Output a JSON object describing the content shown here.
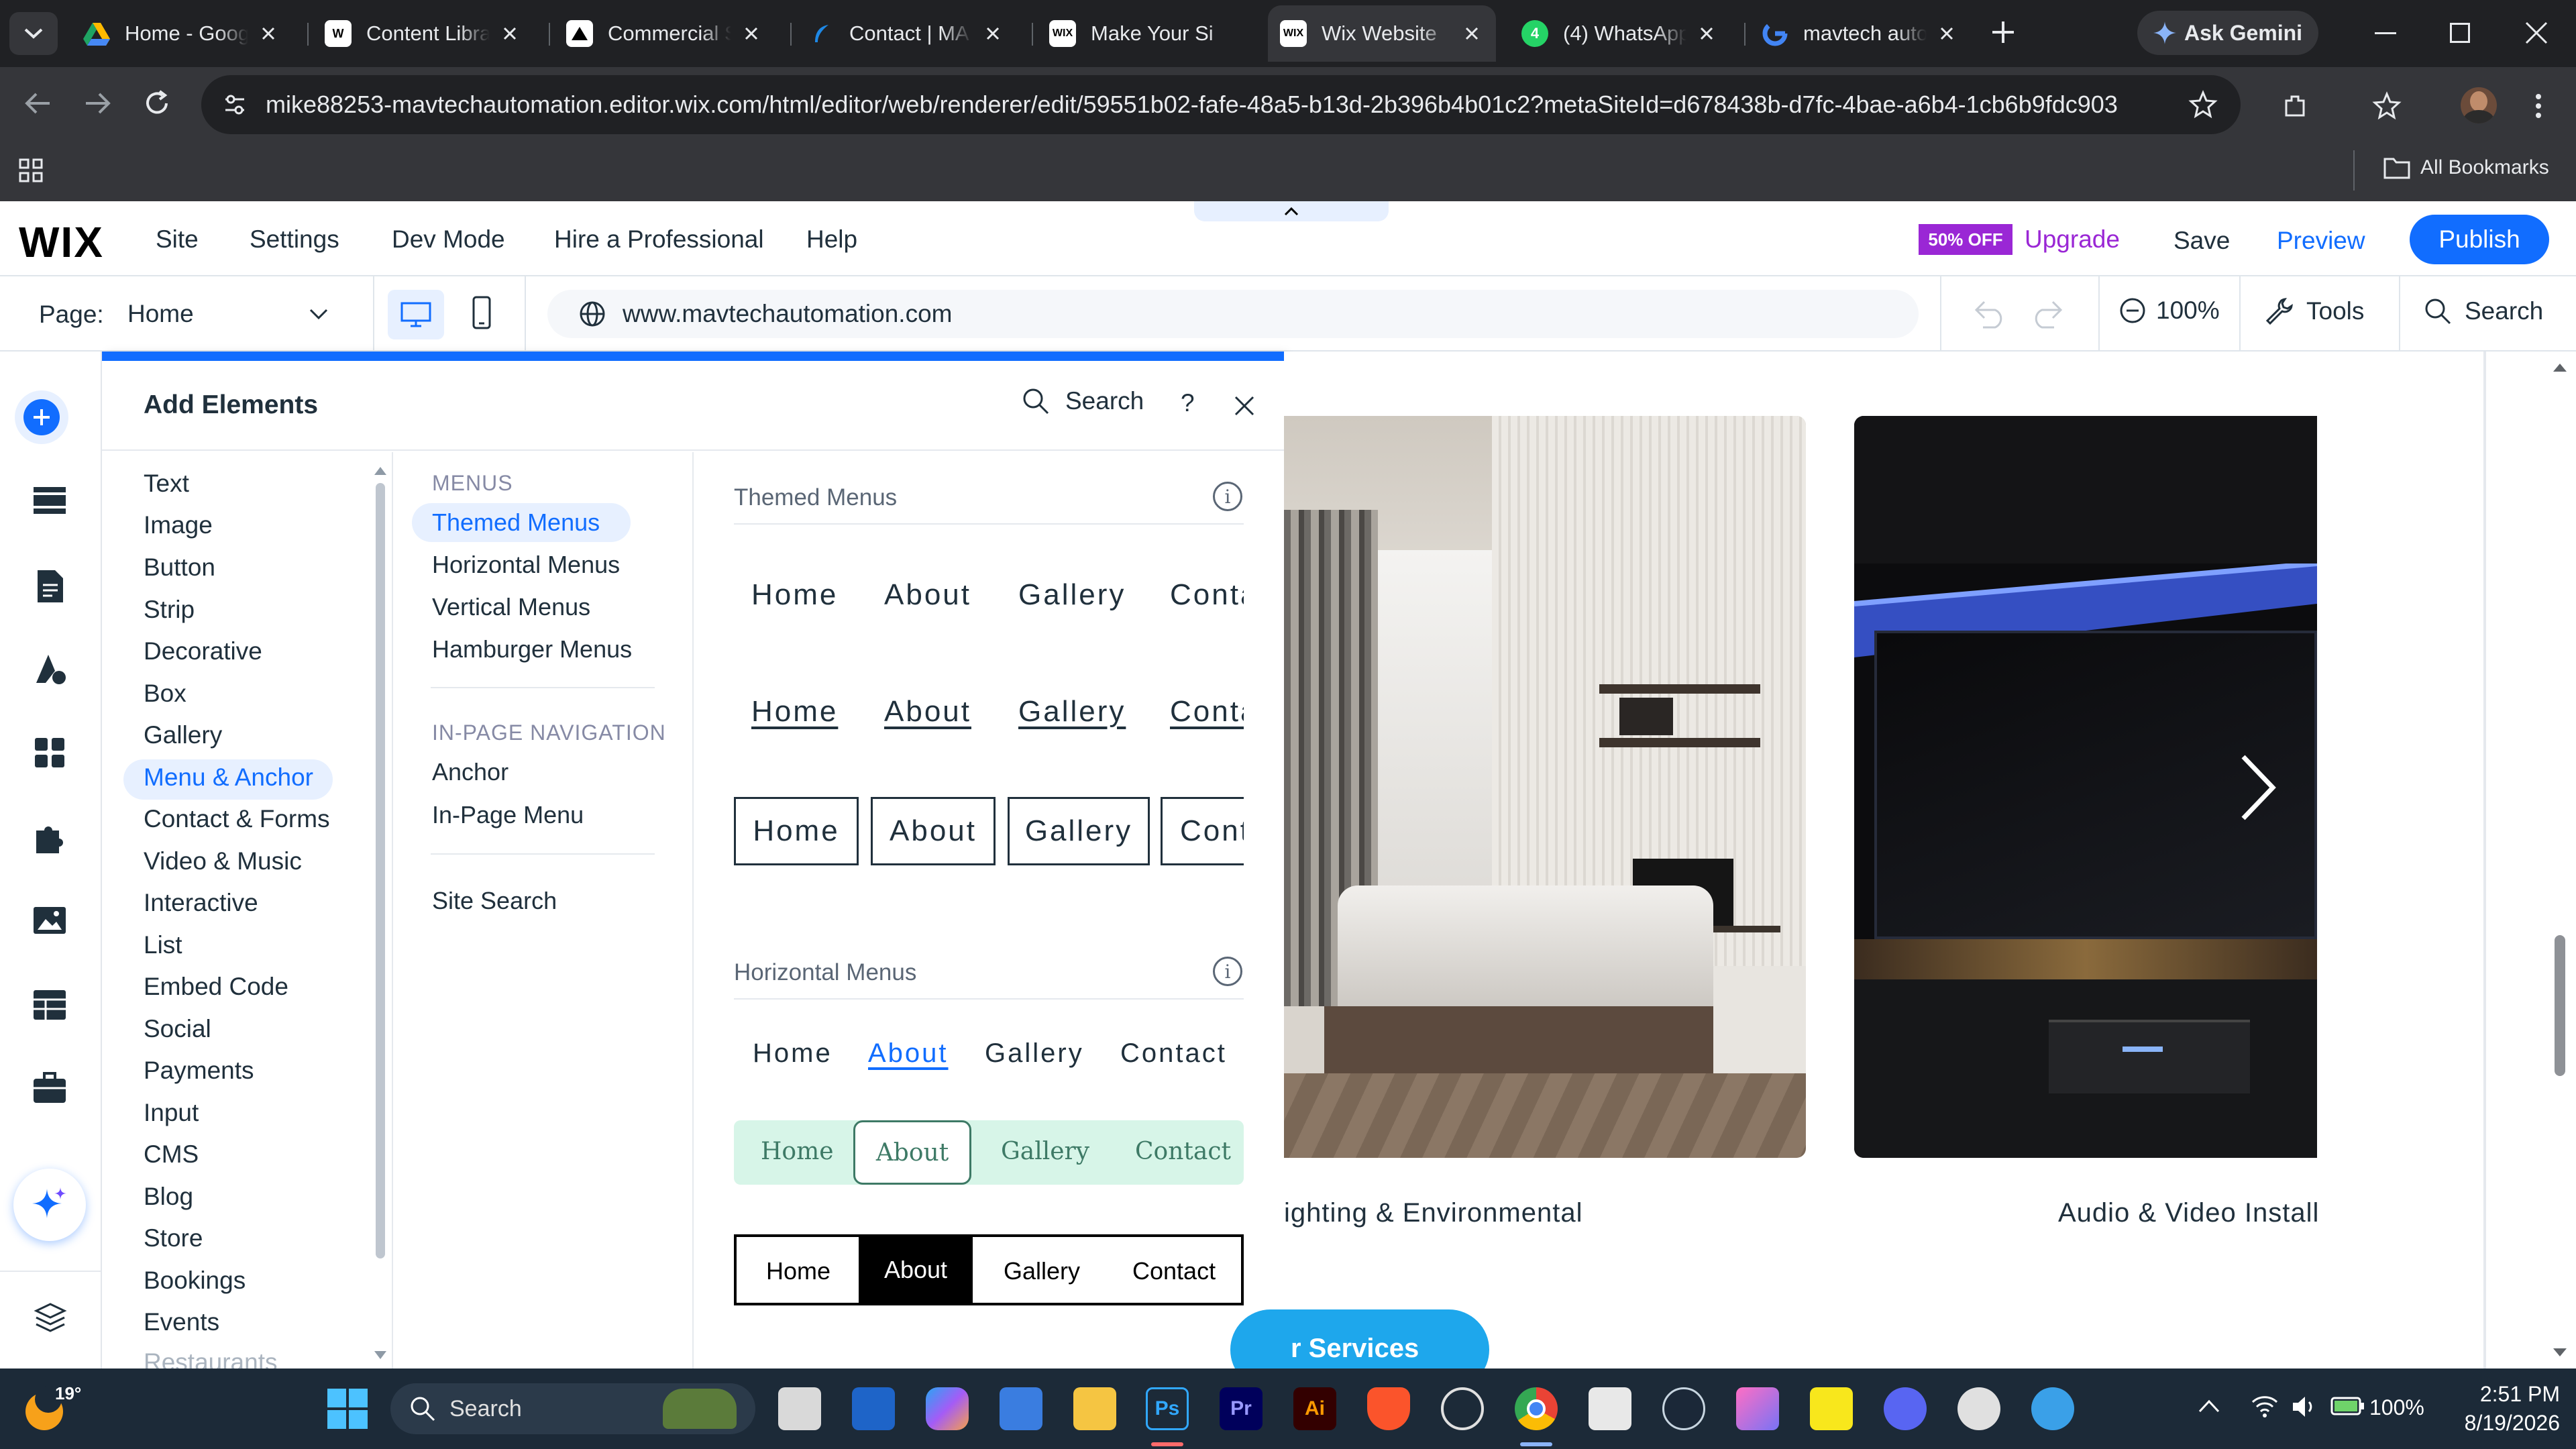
{
  "browser": {
    "tabs": [
      {
        "title": "Home - Goog",
        "favicon": "google-drive-icon",
        "active": false
      },
      {
        "title": "Content Libra",
        "favicon": "wix-icon",
        "active": false
      },
      {
        "title": "Commercial S",
        "favicon": "triangle-icon",
        "active": false
      },
      {
        "title": "Contact | MA",
        "favicon": "feather-icon",
        "active": false
      },
      {
        "title": "Make Your Si",
        "favicon": "wix-icon",
        "active": false
      },
      {
        "title": "Wix Website",
        "favicon": "wix-icon",
        "active": true
      },
      {
        "title": "(4) WhatsApp",
        "favicon": "whatsapp-icon",
        "badge": "4",
        "active": false
      },
      {
        "title": "mavtech auto",
        "favicon": "google-icon",
        "active": false
      }
    ],
    "ask_gemini": "Ask Gemini",
    "url": "mike88253-mavtechautomation.editor.wix.com/html/editor/web/renderer/edit/59551b02-fafe-48a5-b13d-2b396b4b01c2?metaSiteId=d678438b-d7fc-4bae-a6b4-1cb6b9fdc903",
    "all_bookmarks": "All Bookmarks"
  },
  "wix": {
    "logo": "WIX",
    "menu": [
      "Site",
      "Settings",
      "Dev Mode",
      "Hire a Professional",
      "Help"
    ],
    "discount_badge": "50% OFF",
    "upgrade": "Upgrade",
    "save": "Save",
    "preview": "Preview",
    "publish": "Publish",
    "page_label": "Page:",
    "page_value": "Home",
    "site_url": "www.mavtechautomation.com",
    "zoom": "100%",
    "tools": "Tools",
    "search": "Search"
  },
  "panel": {
    "title": "Add Elements",
    "search": "Search",
    "help": "?",
    "categories": [
      "Text",
      "Image",
      "Button",
      "Strip",
      "Decorative",
      "Box",
      "Gallery",
      "Menu & Anchor",
      "Contact & Forms",
      "Video & Music",
      "Interactive",
      "List",
      "Embed Code",
      "Social",
      "Payments",
      "Input",
      "CMS",
      "Blog",
      "Store",
      "Bookings",
      "Events",
      "Restaurants"
    ],
    "active_category": "Menu & Anchor",
    "menus_heading": "MENUS",
    "menus_items": [
      "Themed Menus",
      "Horizontal Menus",
      "Vertical Menus",
      "Hamburger Menus"
    ],
    "inpage_heading": "IN-PAGE NAVIGATION",
    "inpage_items": [
      "Anchor",
      "In-Page Menu"
    ],
    "site_search": "Site Search",
    "themed_title": "Themed Menus",
    "themed_rows": [
      [
        "Home",
        "About",
        "Gallery",
        "Conta"
      ],
      [
        "Home",
        "About",
        "Gallery",
        "Conta"
      ],
      [
        "Home",
        "About",
        "Gallery",
        "Cont"
      ]
    ],
    "horizontal_title": "Horizontal Menus",
    "horizontal_rows": [
      [
        "Home",
        "About",
        "Gallery",
        "Contact"
      ],
      [
        "Home",
        "About",
        "Gallery",
        "Contact"
      ],
      [
        "Home",
        "About",
        "Gallery",
        "Contact"
      ]
    ]
  },
  "canvas": {
    "caption_left": "ighting & Environmental",
    "caption_right": "Audio & Video Install",
    "services_button": "r Services"
  },
  "taskbar": {
    "weather": "19°",
    "search": "Search",
    "battery": "100%",
    "time": "2:51 PM",
    "date": "8/19/2026",
    "apps": [
      {
        "name": "Ps",
        "color": "#001e36",
        "fg": "#31a8ff"
      },
      {
        "name": "Pr",
        "color": "#00005b",
        "fg": "#9999ff"
      },
      {
        "name": "Ai",
        "color": "#330000",
        "fg": "#ff9a00"
      }
    ]
  }
}
